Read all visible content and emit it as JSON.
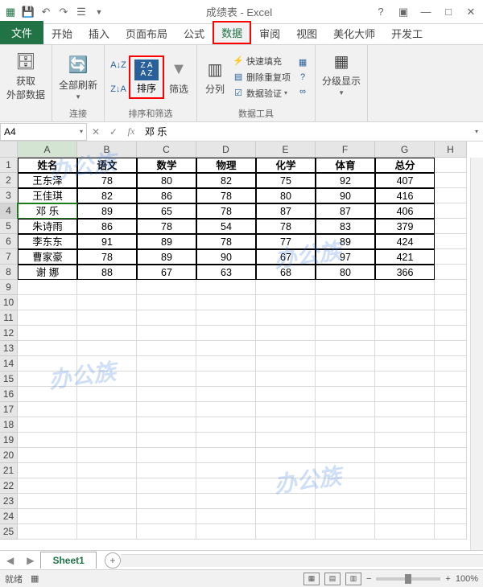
{
  "title": "成绩表 - Excel",
  "tabs": {
    "file": "文件",
    "home": "开始",
    "insert": "插入",
    "layout": "页面布局",
    "formula": "公式",
    "data": "数据",
    "review": "审阅",
    "view": "视图",
    "beauty": "美化大师",
    "dev": "开发工"
  },
  "ribbon": {
    "get_data": "获取\n外部数据",
    "refresh": "全部刷新",
    "conn_group": "连接",
    "sort": "排序",
    "filter": "筛选",
    "sort_group": "排序和筛选",
    "text_col": "分列",
    "flash": "快速填充",
    "dedup": "删除重复项",
    "validate": "数据验证",
    "consolidate": "合并计算",
    "what_if": "模拟分析",
    "relations": "关系",
    "tools_group": "数据工具",
    "outline": "分级显示"
  },
  "namebox": "A4",
  "formula": "邓  乐",
  "cols": [
    "A",
    "B",
    "C",
    "D",
    "E",
    "F",
    "G",
    "H"
  ],
  "table": {
    "header": [
      "姓名",
      "语文",
      "数学",
      "物理",
      "化学",
      "体育",
      "总分"
    ],
    "rows": [
      [
        "王东泽",
        "78",
        "80",
        "82",
        "75",
        "92",
        "407"
      ],
      [
        "王佳琪",
        "82",
        "86",
        "78",
        "80",
        "90",
        "416"
      ],
      [
        "邓  乐",
        "89",
        "65",
        "78",
        "87",
        "87",
        "406"
      ],
      [
        "朱诗雨",
        "86",
        "78",
        "54",
        "78",
        "83",
        "379"
      ],
      [
        "李东东",
        "91",
        "89",
        "78",
        "77",
        "89",
        "424"
      ],
      [
        "曹家豪",
        "78",
        "89",
        "90",
        "67",
        "97",
        "421"
      ],
      [
        "谢  娜",
        "88",
        "67",
        "63",
        "68",
        "80",
        "366"
      ]
    ]
  },
  "sheet_tab": "Sheet1",
  "status": "就绪",
  "zoom": "100%",
  "watermark": "办公族"
}
